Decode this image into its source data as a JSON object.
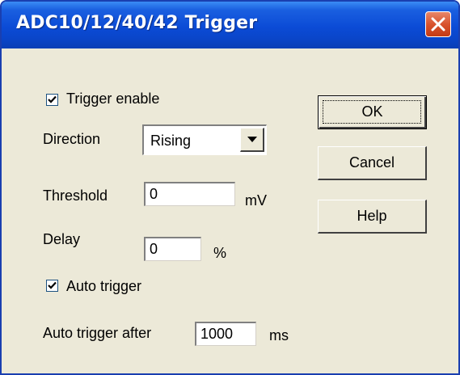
{
  "window": {
    "title": "ADC10/12/40/42 Trigger"
  },
  "trigger_enable": {
    "label": "Trigger enable",
    "checked": true
  },
  "direction": {
    "label": "Direction",
    "value": "Rising"
  },
  "threshold": {
    "label": "Threshold",
    "value": "0",
    "unit": "mV"
  },
  "delay": {
    "label": "Delay",
    "value": "0",
    "unit": "%"
  },
  "auto_trigger": {
    "label": "Auto trigger",
    "checked": true
  },
  "auto_trigger_after": {
    "label": "Auto trigger after",
    "value": "1000",
    "unit": "ms"
  },
  "buttons": {
    "ok": "OK",
    "cancel": "Cancel",
    "help": "Help"
  },
  "icons": {
    "close": "close-icon",
    "check": "checkmark-icon",
    "dropdown": "dropdown-arrow-icon"
  },
  "colors": {
    "titlebar": "#0b4bd6",
    "close_button": "#d9532e",
    "dialog_background": "#ece9d8"
  }
}
